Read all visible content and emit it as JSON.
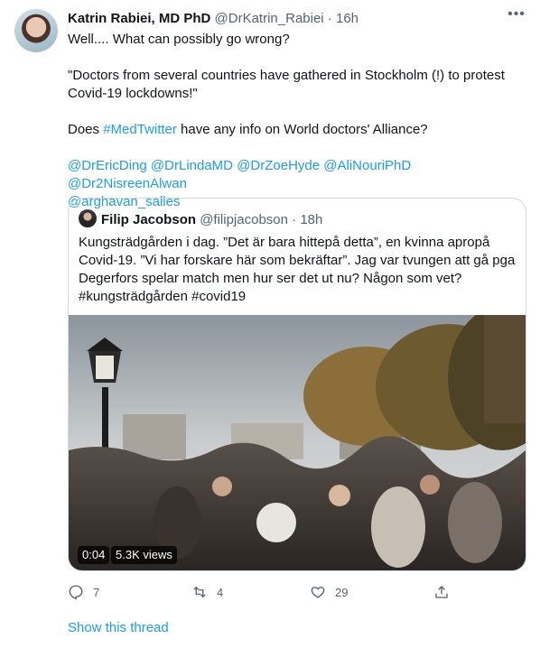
{
  "tweet": {
    "author_name": "Katrin Rabiei, MD PhD",
    "handle": "@DrKatrin_Rabiei",
    "separator": "·",
    "time": "16h",
    "line1": "Well.... What can possibly go wrong?",
    "line2a": "\"Doctors from several countries have gathered in Stockholm (!) to protest",
    "line2b": "Covid-19 lockdowns!\"",
    "line3_prefix": "Does ",
    "hashtag": "#MedTwitter",
    "line3_suffix": " have any info on World doctors' Alliance?",
    "mentions": [
      "@DrEricDing",
      "@DrLindaMD",
      "@DrZoeHyde",
      "@AliNouriPhD",
      "@Dr2NisreenAlwan",
      "@arghavan_salles"
    ]
  },
  "quote": {
    "author_name": "Filip Jacobson",
    "handle": "@filipjacobson",
    "separator": "·",
    "time": "18h",
    "line1": "Kungsträdgården i dag. ”Det är bara hittepå detta”, en kvinna apropå",
    "line2": "Covid-19. ”Vi har forskare här som bekräftar”. Jag var tvungen att gå pga",
    "line3": "Degerfors spelar match men hur ser det ut nu? Någon som vet?",
    "hashtag1": "#kungsträdgården",
    "hashtag2": "#covid19",
    "video": {
      "duration": "0:04",
      "views": "5.3K views"
    }
  },
  "actions": {
    "replies": "7",
    "retweets": "4",
    "likes": "29",
    "icons": [
      "reply-icon",
      "retweet-icon",
      "like-icon",
      "share-icon"
    ]
  },
  "show_thread": "Show this thread",
  "colors": {
    "link": "#1d9bf0",
    "muted": "#536471",
    "border": "#cfd9de",
    "text": "#0f1419"
  }
}
